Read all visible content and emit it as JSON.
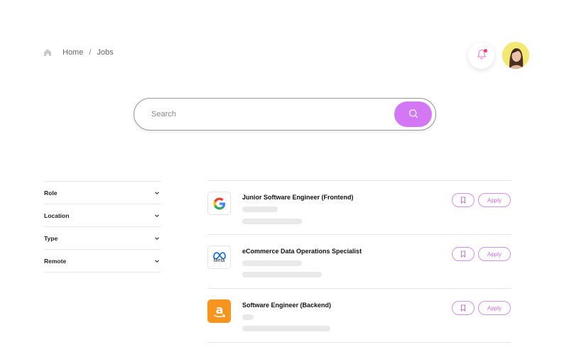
{
  "breadcrumb": {
    "home_icon": "home-icon",
    "items": [
      "Home",
      "Jobs"
    ],
    "separator": "/"
  },
  "header": {
    "bell_icon": "bell-icon",
    "has_notification": true,
    "accent": "#ff3b72"
  },
  "search": {
    "placeholder": "Search",
    "value": "",
    "button_icon": "search-icon",
    "button_color": "#d477f4"
  },
  "filters": [
    {
      "label": "Role"
    },
    {
      "label": "Location"
    },
    {
      "label": "Type"
    },
    {
      "label": "Remote"
    }
  ],
  "jobs": [
    {
      "company_logo": "google-logo",
      "title": "Junior Software Engineer (Frontend)",
      "apply_label": "Apply"
    },
    {
      "company_logo": "meta-logo",
      "logo_text": "Meta",
      "title": "eCommerce Data Operations Specialist",
      "apply_label": "Apply"
    },
    {
      "company_logo": "amazon-logo",
      "title": "Software Engineer (Backend)",
      "apply_label": "Apply"
    }
  ]
}
